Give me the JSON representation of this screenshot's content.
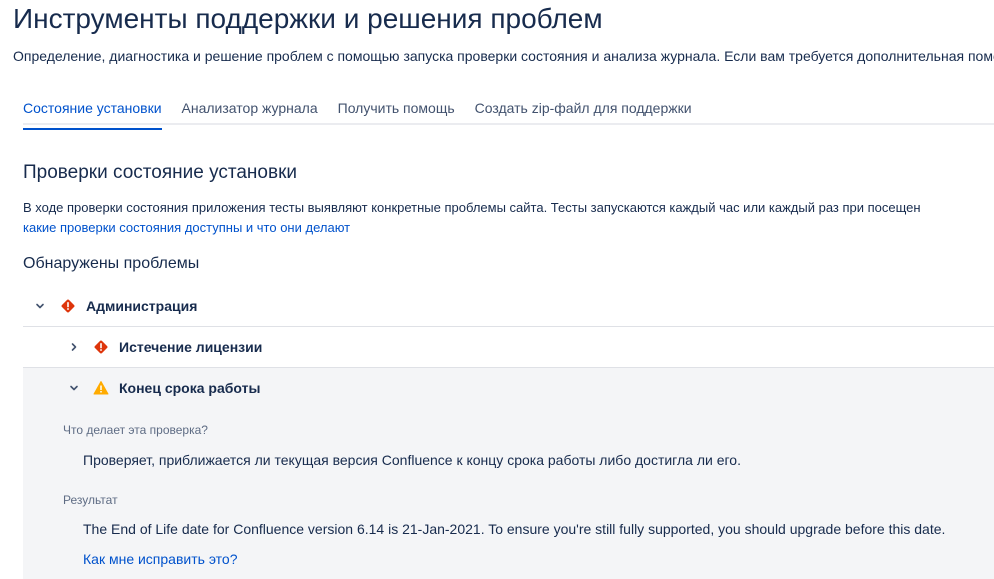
{
  "page": {
    "title": "Инструменты поддержки и решения проблем",
    "subtitle": "Определение, диагностика и решение проблем с помощью запуска проверки состояния и анализа журнала. Если вам требуется дополнительная помощь"
  },
  "tabs": [
    {
      "label": "Состояние установки",
      "active": true
    },
    {
      "label": "Анализатор журнала",
      "active": false
    },
    {
      "label": "Получить помощь",
      "active": false
    },
    {
      "label": "Создать zip-файл для поддержки",
      "active": false
    }
  ],
  "health": {
    "title": "Проверки состояние установки",
    "description": "В ходе проверки состояния приложения тесты выявляют конкретные проблемы сайта. Тесты запускаются каждый час или каждый раз при посещен",
    "link": "какие проверки состояния доступны и что они делают",
    "problems_title": "Обнаружены проблемы"
  },
  "checks": {
    "admin": {
      "label": "Администрация",
      "icon": "error-icon",
      "chevron": "⌄"
    },
    "license": {
      "label": "Истечение лицензии",
      "icon": "error-icon",
      "chevron": "›"
    },
    "eol": {
      "label": "Конец срока работы",
      "icon": "warning-icon",
      "chevron": "⌄",
      "what_label": "Что делает эта проверка?",
      "what_text": "Проверяет, приближается ли текущая версия Confluence к концу срока работы либо достигла ли его.",
      "result_label": "Результат",
      "result_text": "The End of Life date for Confluence version 6.14 is 21-Jan-2021. To ensure you're still fully supported, you should upgrade before this date.",
      "fix_link": "Как мне исправить это?"
    }
  },
  "colors": {
    "error": "#de350b",
    "warning": "#ffab00",
    "link": "#0052cc"
  }
}
